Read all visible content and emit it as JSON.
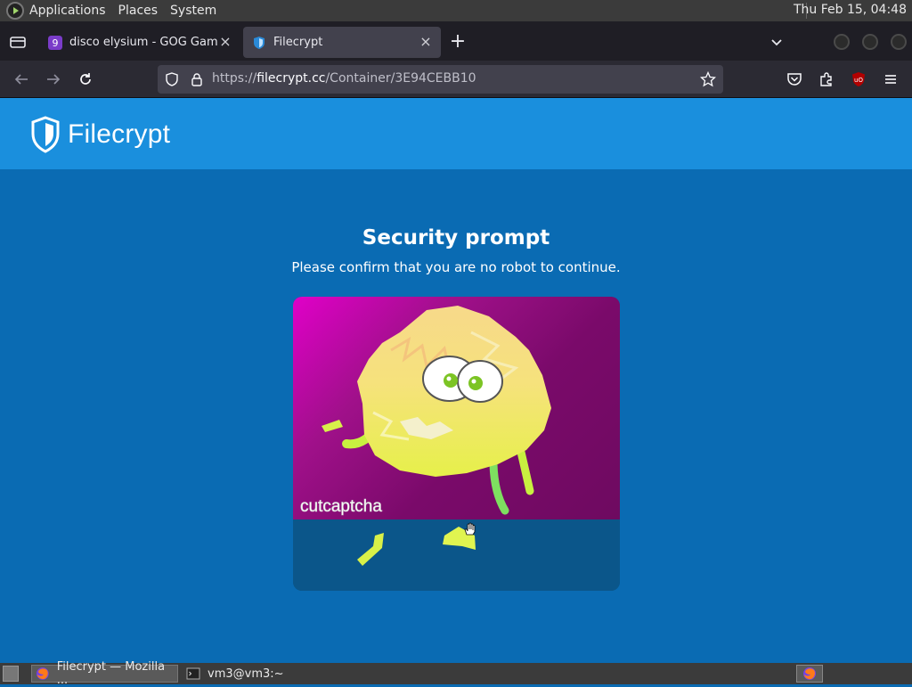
{
  "system_panel": {
    "menus": [
      "Applications",
      "Places",
      "System"
    ],
    "clock": "Thu Feb 15, 04:48"
  },
  "browser": {
    "tabs": [
      {
        "title": "disco elysium - GOG Games",
        "favicon": "gog-favicon",
        "active": false
      },
      {
        "title": "Filecrypt",
        "favicon": "filecrypt-shield-favicon",
        "active": true
      }
    ],
    "url": {
      "scheme": "https://",
      "host": "filecrypt.cc",
      "path": "/Container/3E94CEBB10"
    }
  },
  "page": {
    "brand": "Filecrypt",
    "title": "Security prompt",
    "subtitle": "Please confirm that you are no robot to continue.",
    "captcha_logo": "cutcaptcha"
  },
  "taskbar": {
    "tasks": [
      {
        "label": "Filecrypt — Mozilla ...",
        "icon": "firefox-icon"
      },
      {
        "label": "vm3@vm3:~",
        "icon": "terminal-icon"
      }
    ]
  },
  "colors": {
    "page_bg": "#0a6bb3",
    "header_bg": "#1a8fdd",
    "captcha_bg": "#6e0a60",
    "browser_chrome": "#2b2a33"
  }
}
